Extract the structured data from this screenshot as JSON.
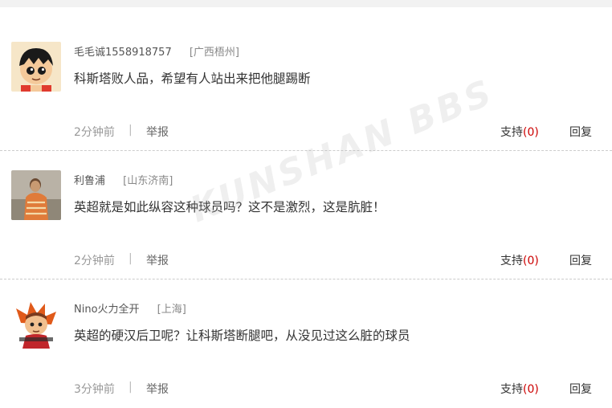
{
  "comments": [
    {
      "username": "毛毛诚1558918757",
      "location": "[广西梧州]",
      "text": "科斯塔败人品，希望有人站出来把他腿踢断",
      "time": "2分钟前",
      "separator": "|",
      "report_label": "举报",
      "support_label": "支持",
      "support_count": "(0)",
      "reply_label": "回复",
      "avatar_icon": "cartoon-boy-avatar-icon"
    },
    {
      "username": "利鲁浦",
      "location": "[山东济南]",
      "text": "英超就是如此纵容这种球员吗？这不是激烈，这是肮脏！",
      "time": "2分钟前",
      "separator": "|",
      "report_label": "举报",
      "support_label": "支持",
      "support_count": "(0)",
      "reply_label": "回复",
      "avatar_icon": "photo-person-avatar-icon"
    },
    {
      "username": "Nino火力全开",
      "location": "[上海]",
      "text": "英超的硬汉后卫呢？让科斯塔断腿吧，从没见过这么脏的球员",
      "time": "3分钟前",
      "separator": "|",
      "report_label": "举报",
      "support_label": "支持",
      "support_count": "(0)",
      "reply_label": "回复",
      "avatar_icon": "cartoon-character-avatar-icon"
    }
  ],
  "watermark_text": "KUNSHAN BBS",
  "colors": {
    "support_count": "#cc0000",
    "time": "#999999",
    "divider": "#cccccc"
  }
}
